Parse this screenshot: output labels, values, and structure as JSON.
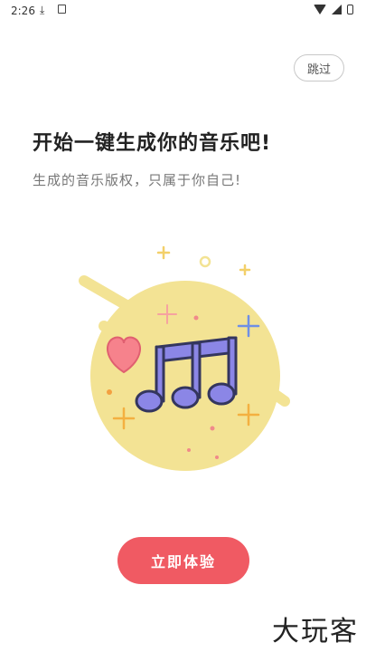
{
  "status_bar": {
    "time": "2:26"
  },
  "skip_label": "跳过",
  "title": "开始一键生成你的音乐吧!",
  "subtitle": "生成的音乐版权，只属于你自己!",
  "start_button_label": "立即体验",
  "watermark": "大玩客",
  "colors": {
    "accent": "#f05a63",
    "circle": "#f3e394",
    "note": "#8b86e6",
    "heart": "#f6828c"
  },
  "icons": [
    "download-icon",
    "sim-icon",
    "wifi-icon",
    "signal-icon",
    "battery-icon",
    "music-note-icon",
    "heart-icon",
    "sparkle-icon"
  ]
}
